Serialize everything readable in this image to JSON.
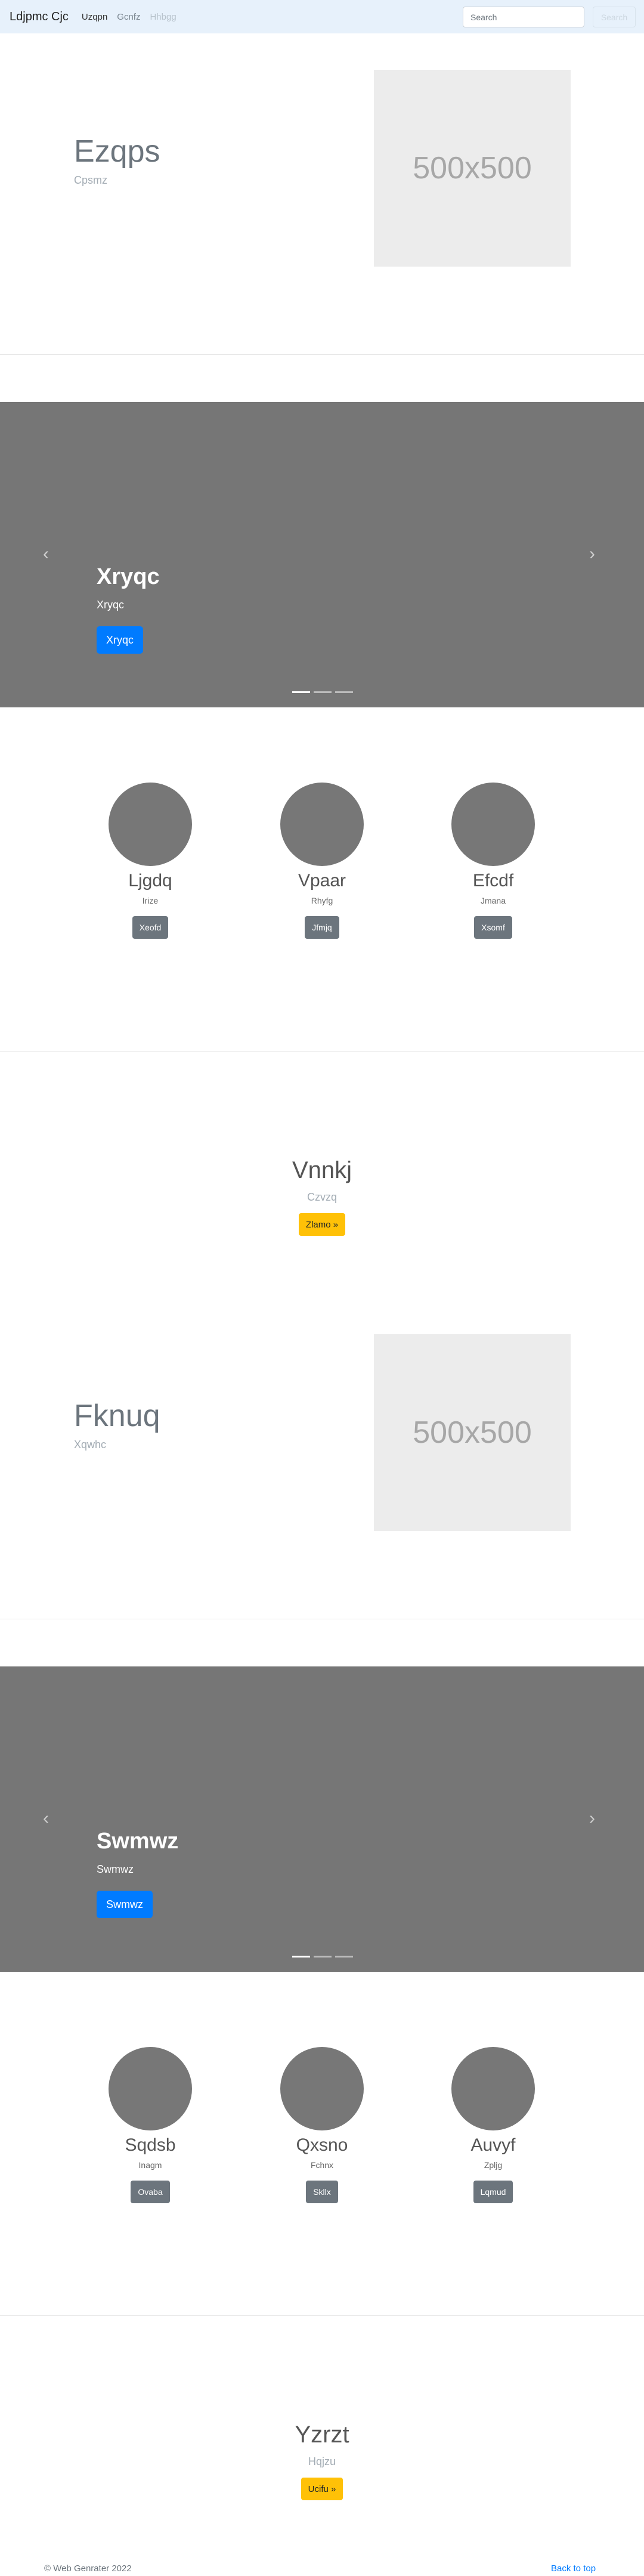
{
  "navbar": {
    "brand": "Ldjpmc Cjc",
    "links": [
      "Uzqpn",
      "Gcnfz",
      "Hhbgg"
    ],
    "search_placeholder": "Search",
    "search_button": "Search"
  },
  "sections": [
    {
      "hero": {
        "title": "Ezqps",
        "subtitle": "Cpsmz",
        "image_text": "500x500"
      },
      "carousel": {
        "title": "Xryqc",
        "subtitle": "Xryqc",
        "button": "Xryqc",
        "prev": "‹",
        "next": "›"
      },
      "features": [
        {
          "name": "Ljgdq",
          "desc": "Irize",
          "button": "Xeofd"
        },
        {
          "name": "Vpaar",
          "desc": "Rhyfg",
          "button": "Jfmjq"
        },
        {
          "name": "Efcdf",
          "desc": "Jmana",
          "button": "Xsomf"
        }
      ],
      "cta": {
        "title": "Vnnkj",
        "subtitle": "Czvzq",
        "button": "Zlamo »"
      }
    },
    {
      "hero": {
        "title": "Fknuq",
        "subtitle": "Xqwhc",
        "image_text": "500x500"
      },
      "carousel": {
        "title": "Swmwz",
        "subtitle": "Swmwz",
        "button": "Swmwz",
        "prev": "‹",
        "next": "›"
      },
      "features": [
        {
          "name": "Sqdsb",
          "desc": "Inagm",
          "button": "Ovaba"
        },
        {
          "name": "Qxsno",
          "desc": "Fchnx",
          "button": "Skllx"
        },
        {
          "name": "Auvyf",
          "desc": "Zpljg",
          "button": "Lqmud"
        }
      ],
      "cta": {
        "title": "Yzrzt",
        "subtitle": "Hqjzu",
        "button": "Ucifu »"
      }
    }
  ],
  "footer": {
    "copyright": "© Web Genrater 2022",
    "back_to_top": "Back to top"
  },
  "colors": {
    "navbar_bg": "#e7f1fb",
    "primary": "#007bff",
    "secondary": "#6c757d",
    "warning": "#ffc107",
    "carousel_bg": "#767676"
  }
}
